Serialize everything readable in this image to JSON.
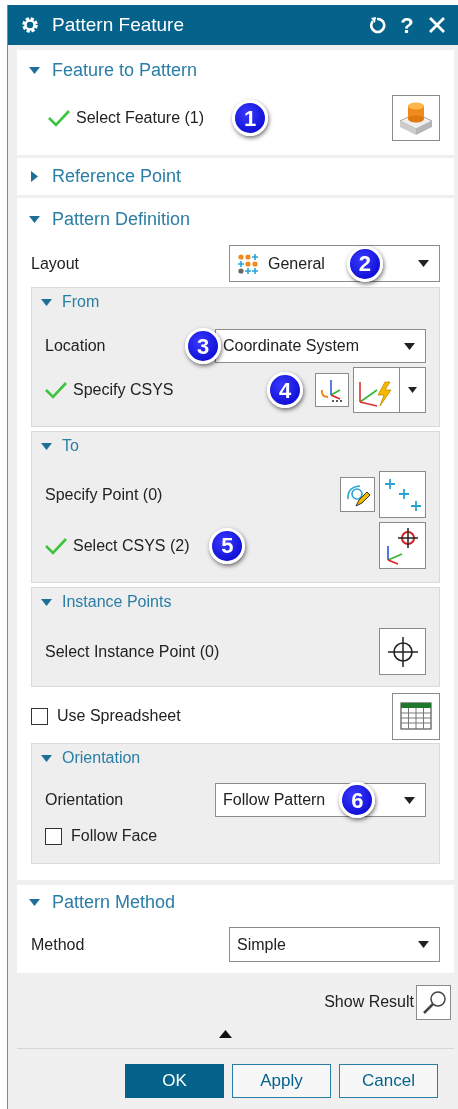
{
  "window": {
    "title": "Pattern Feature",
    "help": "?"
  },
  "feature_to_pattern": {
    "title": "Feature to Pattern",
    "expanded": true,
    "select": {
      "label": "Select Feature (1)",
      "done": true,
      "callout": "1"
    }
  },
  "reference_point": {
    "title": "Reference Point",
    "expanded": false
  },
  "pattern_definition": {
    "title": "Pattern Definition",
    "expanded": true,
    "layout": {
      "label": "Layout",
      "value": "General",
      "callout": "2"
    },
    "from": {
      "title": "From",
      "expanded": true,
      "location": {
        "label": "Location",
        "value": "Coordinate System",
        "callout": "3"
      },
      "specify_csys": {
        "label": "Specify CSYS",
        "done": true,
        "callout": "4"
      }
    },
    "to": {
      "title": "To",
      "expanded": true,
      "specify_point": {
        "label": "Specify Point (0)",
        "done": false
      },
      "select_csys": {
        "label": "Select CSYS (2)",
        "done": true,
        "callout": "5"
      }
    },
    "instance_points": {
      "title": "Instance Points",
      "expanded": true,
      "select": {
        "label": "Select Instance Point (0)",
        "done": false
      }
    },
    "use_spreadsheet": {
      "label": "Use Spreadsheet",
      "checked": false
    },
    "orientation": {
      "title": "Orientation",
      "expanded": true,
      "orientation": {
        "label": "Orientation",
        "value": "Follow Pattern",
        "callout": "6"
      },
      "follow_face": {
        "label": "Follow Face",
        "checked": false
      }
    }
  },
  "pattern_method": {
    "title": "Pattern Method",
    "expanded": true,
    "method": {
      "label": "Method",
      "value": "Simple"
    }
  },
  "show_result": {
    "label": "Show Result"
  },
  "buttons": [
    {
      "label": "OK",
      "kind": "primary"
    },
    {
      "label": "Apply",
      "kind": "secondary"
    },
    {
      "label": "Cancel",
      "kind": "secondary"
    }
  ]
}
